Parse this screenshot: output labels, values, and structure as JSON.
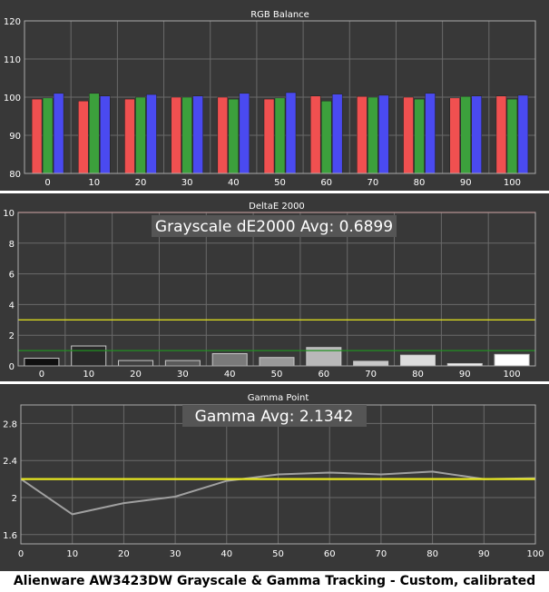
{
  "caption": "Alienware AW3423DW Grayscale & Gamma Tracking - Custom, calibrated",
  "colors": {
    "panel_bg": "#383838",
    "plot_border": "#aaaaaa",
    "grid": "#6a6a6a",
    "red_bar": "#f05050",
    "green_bar": "#3ca03c",
    "blue_bar": "#4a4af0",
    "gamma_measured": "#a0a0a0",
    "gamma_target": "#e8e820",
    "de_red_line": "#e03030",
    "de_yellow_line": "#d8d820",
    "de_green_line": "#209020"
  },
  "chart_data": [
    {
      "type": "bar",
      "title": "RGB Balance",
      "categories": [
        "0",
        "10",
        "20",
        "30",
        "40",
        "50",
        "60",
        "70",
        "80",
        "90",
        "100"
      ],
      "ylim": [
        80,
        120
      ],
      "yticks": [
        "80",
        "90",
        "100",
        "110",
        "120"
      ],
      "series": [
        {
          "color": "red",
          "values": [
            99.5,
            99.0,
            99.5,
            100.0,
            100.0,
            99.5,
            100.3,
            100.2,
            100.0,
            99.8,
            100.3
          ]
        },
        {
          "color": "green",
          "values": [
            99.8,
            101.0,
            100.0,
            100.0,
            99.5,
            99.8,
            99.0,
            100.0,
            99.5,
            100.2,
            99.5
          ]
        },
        {
          "color": "blue",
          "values": [
            101.0,
            100.3,
            100.7,
            100.3,
            101.0,
            101.2,
            100.8,
            100.5,
            101.0,
            100.3,
            100.5
          ]
        }
      ],
      "grid": true
    },
    {
      "type": "bar",
      "title": "DeltaE 2000",
      "annotation": "Grayscale dE2000 Avg: 0.6899",
      "categories": [
        "0",
        "10",
        "20",
        "30",
        "40",
        "50",
        "60",
        "70",
        "80",
        "90",
        "100"
      ],
      "ylim": [
        0,
        10
      ],
      "yticks": [
        "0",
        "2",
        "4",
        "6",
        "8",
        "10"
      ],
      "values": [
        0.5,
        1.3,
        0.35,
        0.35,
        0.8,
        0.55,
        1.2,
        0.3,
        0.7,
        0.15,
        0.75
      ],
      "bar_shades": [
        "#101010",
        "#2a2a2a",
        "#404040",
        "#5a5a5a",
        "#7a7a7a",
        "#9a9a9a",
        "#b8b8b8",
        "#c8c8c8",
        "#dcdcdc",
        "#eeeeee",
        "#ffffff"
      ],
      "reference_lines": [
        {
          "value": 10,
          "color": "red"
        },
        {
          "value": 3,
          "color": "yellow"
        },
        {
          "value": 1,
          "color": "green"
        }
      ],
      "grid": true
    },
    {
      "type": "line",
      "title": "Gamma Point",
      "annotation": "Gamma Avg: 2.1342",
      "x": [
        0,
        10,
        20,
        30,
        40,
        50,
        60,
        70,
        80,
        90,
        100
      ],
      "xticks": [
        "0",
        "10",
        "20",
        "30",
        "40",
        "50",
        "60",
        "70",
        "80",
        "90",
        "100"
      ],
      "ylim": [
        1.5,
        3.0
      ],
      "yticks": [
        "1.6",
        "2",
        "2.4",
        "2.8"
      ],
      "series": [
        {
          "color": "gray",
          "values": [
            2.2,
            1.82,
            1.94,
            2.01,
            2.18,
            2.25,
            2.27,
            2.25,
            2.28,
            2.2,
            2.21
          ]
        },
        {
          "color": "yellow",
          "values": [
            2.2,
            2.2,
            2.2,
            2.2,
            2.2,
            2.2,
            2.2,
            2.2,
            2.2,
            2.2,
            2.2
          ]
        }
      ],
      "grid": true
    }
  ]
}
